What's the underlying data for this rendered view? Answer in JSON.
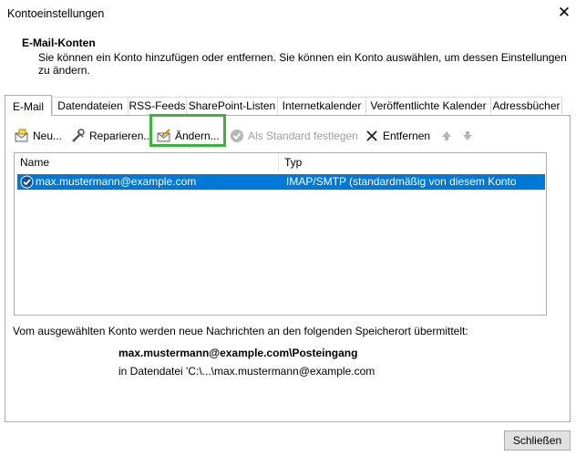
{
  "window": {
    "title": "Kontoeinstellungen",
    "close_glyph": "✕"
  },
  "header": {
    "title": "E-Mail-Konten",
    "description": "Sie können ein Konto hinzufügen oder entfernen. Sie können ein Konto auswählen, um dessen Einstellungen zu ändern."
  },
  "tabs": [
    {
      "label": "E-Mail",
      "active": true
    },
    {
      "label": "Datendateien"
    },
    {
      "label": "RSS-Feeds"
    },
    {
      "label": "SharePoint-Listen"
    },
    {
      "label": "Internetkalender"
    },
    {
      "label": "Veröffentlichte Kalender"
    },
    {
      "label": "Adressbücher"
    }
  ],
  "toolbar": {
    "new": "Neu...",
    "repair": "Reparieren...",
    "change": "Ändern...",
    "default": "Als Standard festlegen",
    "remove": "Entfernen"
  },
  "list": {
    "headers": {
      "name": "Name",
      "type": "Typ"
    },
    "rows": [
      {
        "name": "max.mustermann@example.com",
        "type": "IMAP/SMTP (standardmäßig von diesem Konto senden)",
        "selected": true
      }
    ]
  },
  "info": {
    "line1": "Vom ausgewählten Konto werden neue Nachrichten an den folgenden Speicherort übermittelt:",
    "location": "max.mustermann@example.com\\Posteingang",
    "datafile": "in Datendatei 'C:\\...\\max.mustermann@example.com"
  },
  "footer": {
    "close": "Schließen"
  },
  "colors": {
    "selection": "#0078d7",
    "highlight": "#3cb43c"
  }
}
